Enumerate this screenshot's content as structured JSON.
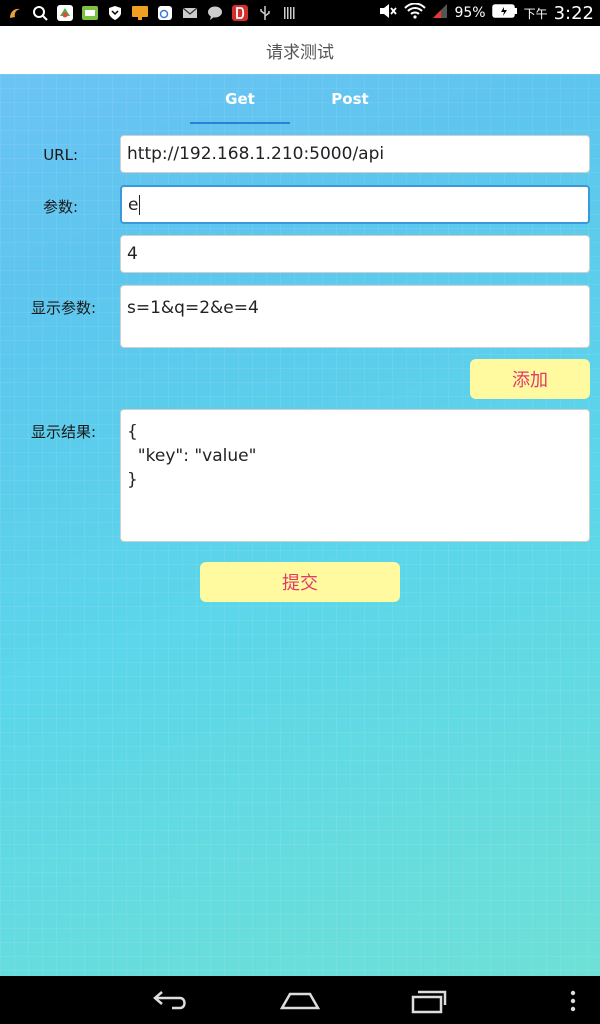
{
  "statusbar": {
    "battery": "95%",
    "time_prefix": "下午",
    "time": "3:22"
  },
  "title": "请求测试",
  "tabs": [
    {
      "label": "Get",
      "active": true
    },
    {
      "label": "Post",
      "active": false
    }
  ],
  "form": {
    "url_label": "URL:",
    "url_value": "http://192.168.1.210:5000/api",
    "param_label": "参数:",
    "param_key": "e",
    "param_value": "4",
    "display_params_label": "显示参数:",
    "display_params_value": "s=1&q=2&e=4",
    "add_button": "添加",
    "result_label": "显示结果:",
    "result_value": "{\n  \"key\": \"value\"\n}",
    "submit_button": "提交"
  },
  "colors": {
    "tab_indicator": "#2d7fd8",
    "button_bg": "#fff9a0",
    "button_text": "#e23b6a"
  }
}
